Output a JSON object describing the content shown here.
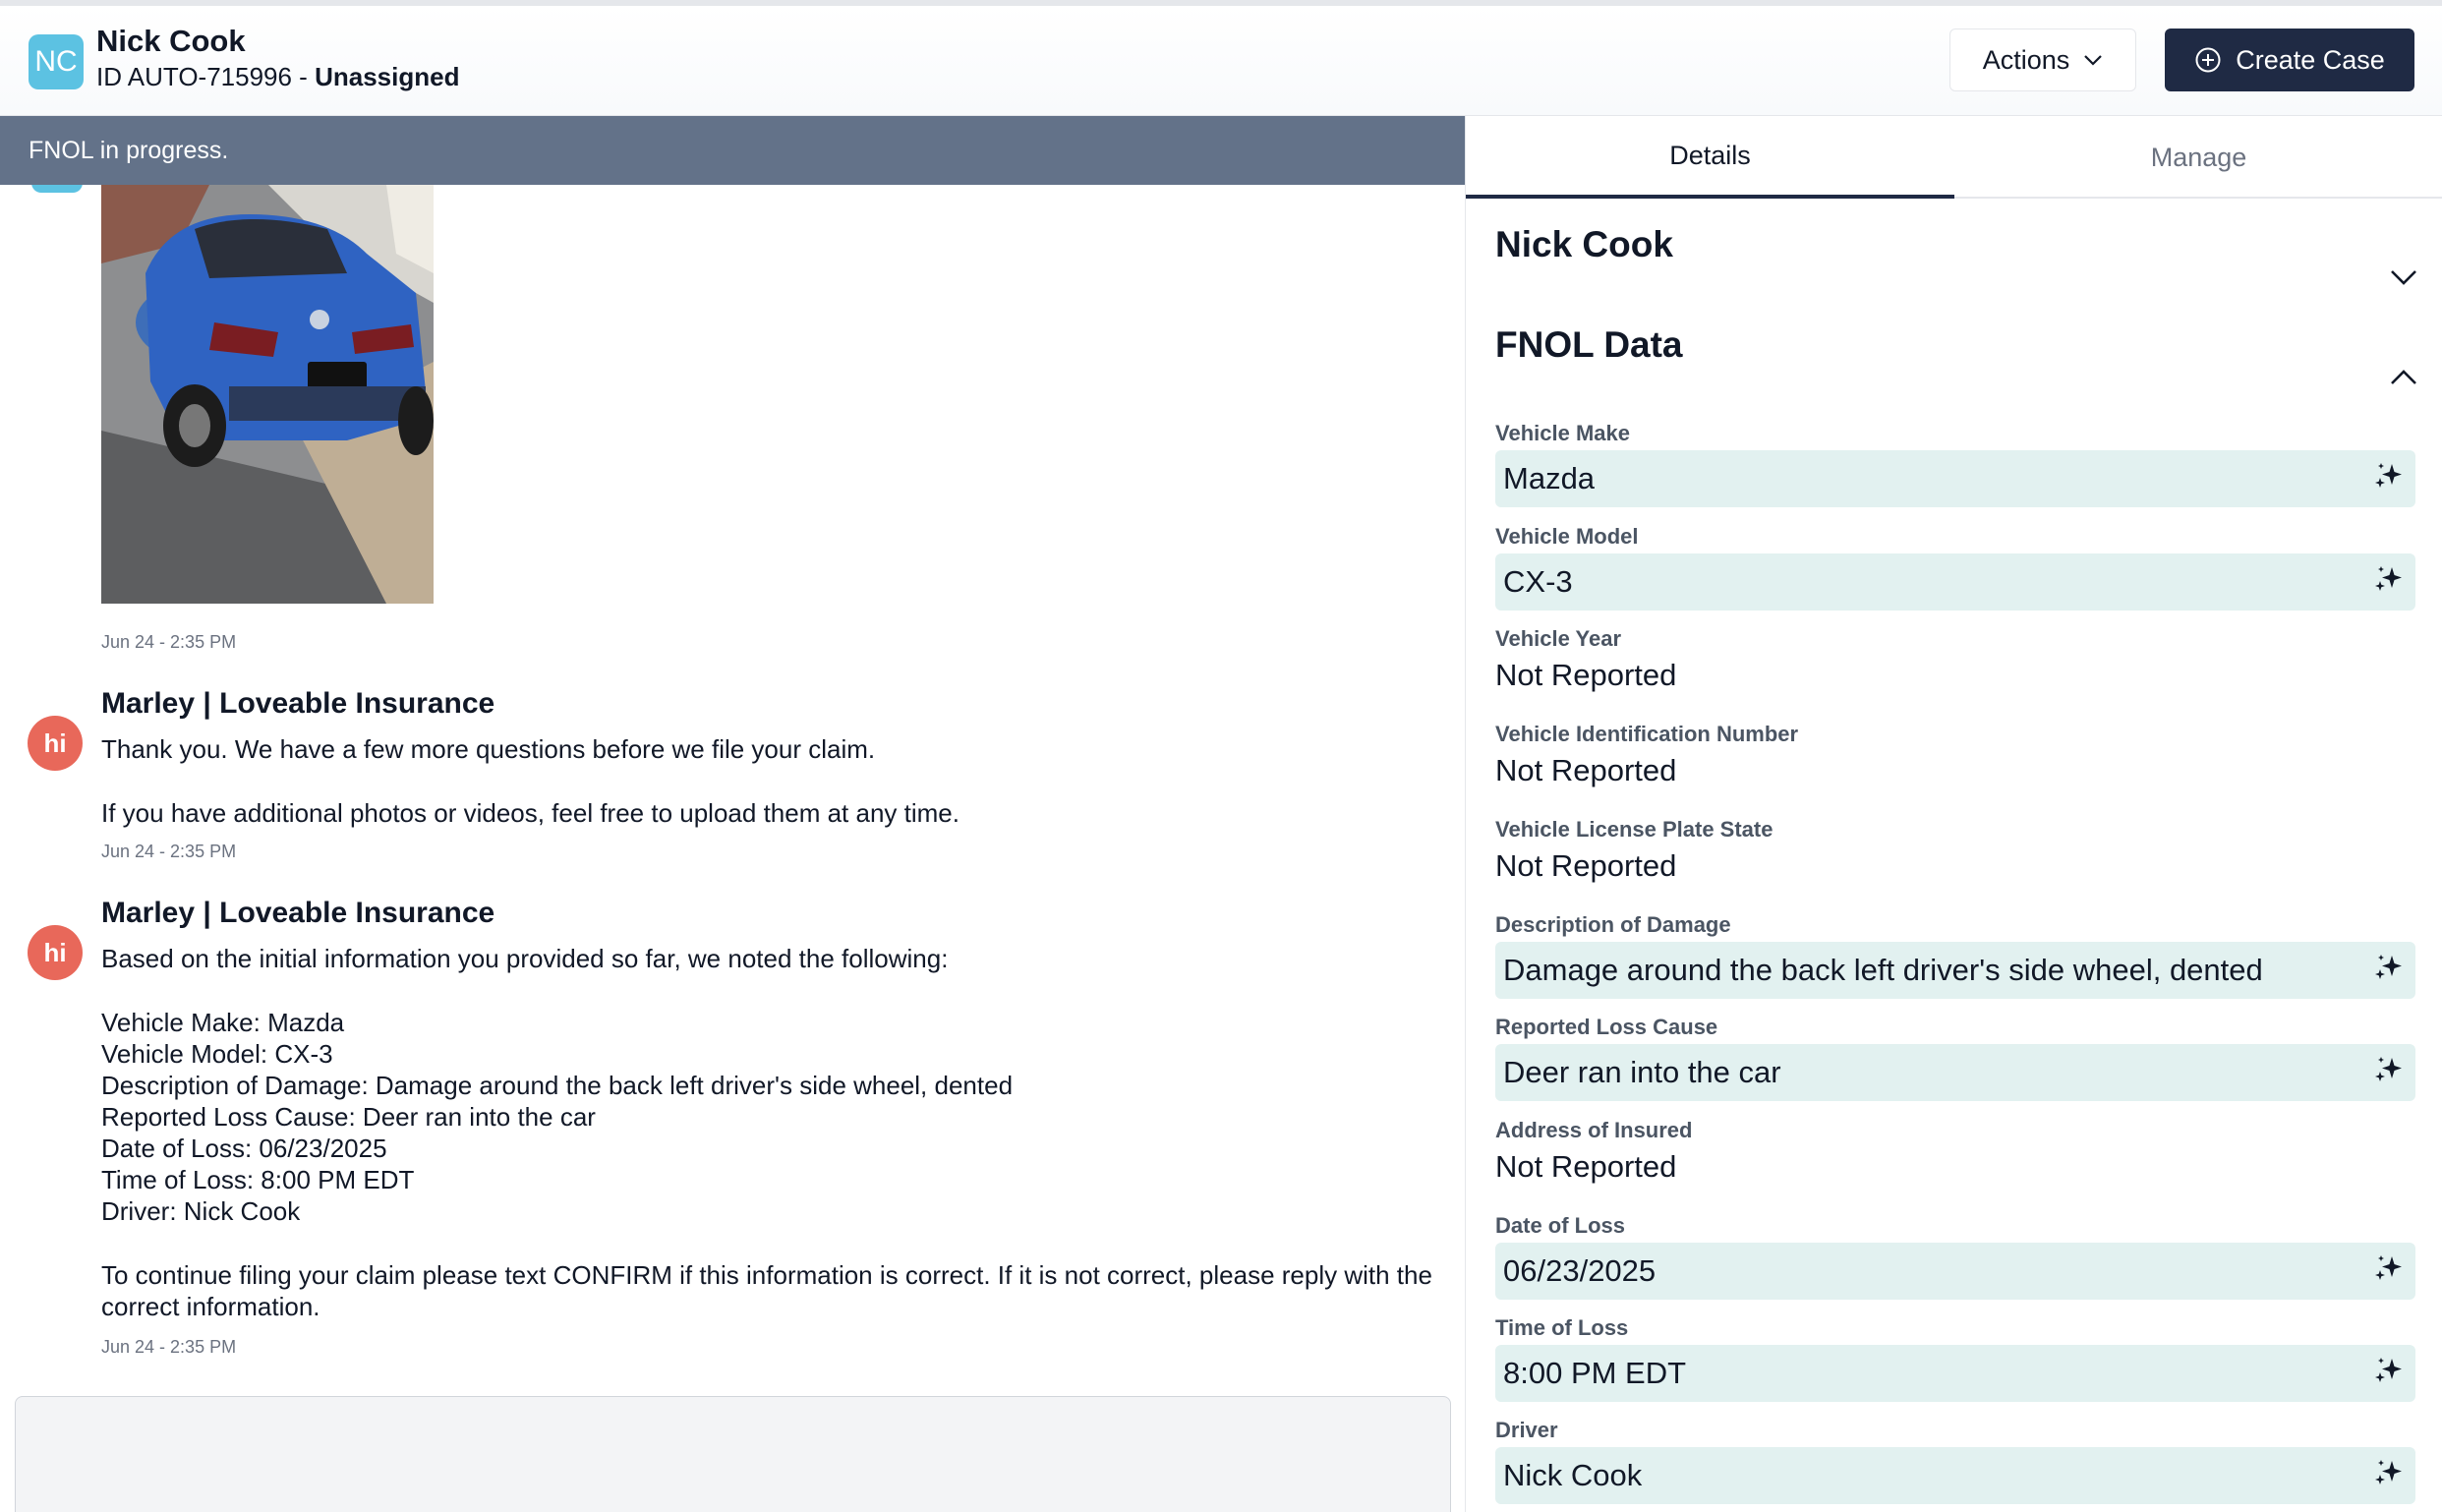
{
  "header": {
    "avatar_initials": "NC",
    "name": "Nick Cook",
    "id_text": "ID AUTO-715996 - ",
    "assignment": "Unassigned",
    "actions_label": "Actions",
    "create_case_label": "Create Case"
  },
  "chat": {
    "banner": "FNOL in progress.",
    "photo_timestamp": "Jun 24 - 2:35 PM",
    "messages": [
      {
        "avatar": "hi",
        "sender": "Marley | Loveable Insurance",
        "lines": [
          "Thank you. We have a few more questions before we file your claim.",
          "",
          "If you have additional photos or videos, feel free to upload them at any time."
        ],
        "timestamp": "Jun 24 - 2:35 PM"
      },
      {
        "avatar": "hi",
        "sender": "Marley | Loveable Insurance",
        "lines": [
          "Based on the initial information you provided so far, we noted the following:",
          "",
          "Vehicle Make: Mazda",
          "Vehicle Model: CX-3",
          "Description of Damage: Damage around the back left driver's side wheel, dented",
          "Reported Loss Cause: Deer ran into the car",
          "Date of Loss: 06/23/2025",
          "Time of Loss: 8:00 PM EDT",
          "Driver: Nick Cook",
          "",
          "To continue filing your claim please text CONFIRM if this information is correct. If it is not correct, please reply with the correct information."
        ],
        "timestamp": "Jun 24 - 2:35 PM"
      }
    ]
  },
  "details": {
    "tabs": [
      "Details",
      "Manage"
    ],
    "person_section": "Nick Cook",
    "fnol_section": "FNOL Data",
    "fields": [
      {
        "label": "Vehicle Make",
        "value": "Mazda",
        "ai_filled": true
      },
      {
        "label": "Vehicle Model",
        "value": "CX-3",
        "ai_filled": true
      },
      {
        "label": "Vehicle Year",
        "value": "Not Reported",
        "ai_filled": false
      },
      {
        "label": "Vehicle Identification Number",
        "value": "Not Reported",
        "ai_filled": false
      },
      {
        "label": "Vehicle License Plate State",
        "value": "Not Reported",
        "ai_filled": false
      },
      {
        "label": "Description of Damage",
        "value": "Damage around the back left driver's side wheel, dented",
        "ai_filled": true
      },
      {
        "label": "Reported Loss Cause",
        "value": "Deer ran into the car",
        "ai_filled": true
      },
      {
        "label": "Address of Insured",
        "value": "Not Reported",
        "ai_filled": false
      },
      {
        "label": "Date of Loss",
        "value": "06/23/2025",
        "ai_filled": true
      },
      {
        "label": "Time of Loss",
        "value": "8:00 PM EDT",
        "ai_filled": true
      },
      {
        "label": "Driver",
        "value": "Nick Cook",
        "ai_filled": true
      }
    ]
  },
  "icons": {
    "actions_chevron": "chevron-down-icon",
    "create_case": "plus-circle-icon",
    "person_toggle": "chevron-down-icon",
    "fnol_toggle": "chevron-up-icon",
    "ai_field": "sparkle-icon"
  },
  "colors": {
    "banner": "#637289",
    "primary_button": "#1f2a44",
    "ai_field_bg": "#e2f1f0",
    "agent_avatar": "#e8685a",
    "user_avatar": "#5cc2e2"
  }
}
